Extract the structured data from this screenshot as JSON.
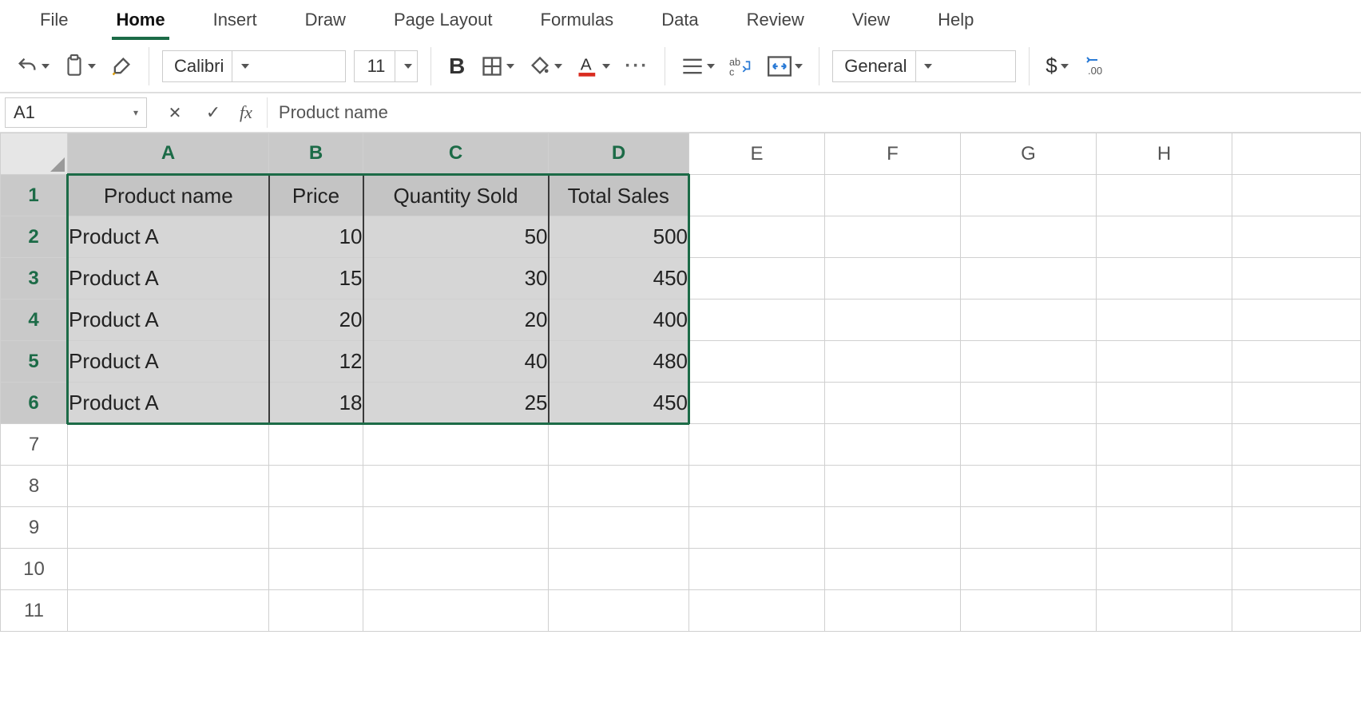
{
  "menu": {
    "tabs": [
      "File",
      "Home",
      "Insert",
      "Draw",
      "Page Layout",
      "Formulas",
      "Data",
      "Review",
      "View",
      "Help"
    ],
    "active": "Home"
  },
  "ribbon": {
    "font_name": "Calibri",
    "font_size": "11",
    "number_format": "General",
    "currency_symbol": "$",
    "decrease_decimal_label": ".00"
  },
  "formulaBar": {
    "name_box": "A1",
    "cancel_glyph": "✕",
    "confirm_glyph": "✓",
    "fx_label": "fx",
    "value": "Product name"
  },
  "sheet": {
    "columns": [
      "A",
      "B",
      "C",
      "D",
      "E",
      "F",
      "G",
      "H"
    ],
    "selected_cols": [
      "A",
      "B",
      "C",
      "D"
    ],
    "row_count": 11,
    "selected_rows": [
      1,
      2,
      3,
      4,
      5,
      6
    ],
    "selection_range": "A1:D6",
    "col_alignment": {
      "A": "txt",
      "B": "num",
      "C": "num",
      "D": "num"
    },
    "headers_row": 1,
    "data": [
      {
        "A": "Product name",
        "B": "Price",
        "C": "Quantity Sold",
        "D": "Total Sales"
      },
      {
        "A": "Product A",
        "B": "10",
        "C": "50",
        "D": "500"
      },
      {
        "A": "Product A",
        "B": "15",
        "C": "30",
        "D": "450"
      },
      {
        "A": "Product A",
        "B": "20",
        "C": "20",
        "D": "400"
      },
      {
        "A": "Product A",
        "B": "12",
        "C": "40",
        "D": "480"
      },
      {
        "A": "Product A",
        "B": "18",
        "C": "25",
        "D": "450"
      }
    ]
  },
  "chart_data": {
    "type": "table",
    "title": "",
    "columns": [
      "Product name",
      "Price",
      "Quantity Sold",
      "Total Sales"
    ],
    "rows": [
      [
        "Product A",
        10,
        50,
        500
      ],
      [
        "Product A",
        15,
        30,
        450
      ],
      [
        "Product A",
        20,
        20,
        400
      ],
      [
        "Product A",
        12,
        40,
        480
      ],
      [
        "Product A",
        18,
        25,
        450
      ]
    ]
  }
}
